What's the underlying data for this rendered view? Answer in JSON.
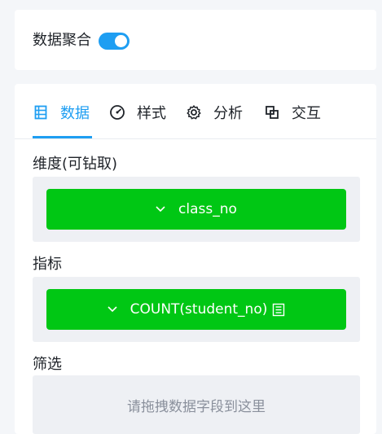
{
  "aggregation": {
    "label": "数据聚合",
    "enabled": true
  },
  "tabs": [
    {
      "label": "数据",
      "icon": "data-table-icon",
      "active": true
    },
    {
      "label": "样式",
      "icon": "dashboard-gauge-icon",
      "active": false
    },
    {
      "label": "分析",
      "icon": "gear-icon",
      "active": false
    },
    {
      "label": "交互",
      "icon": "overlap-squares-icon",
      "active": false
    }
  ],
  "dimension": {
    "label": "维度(可钻取)",
    "field": "class_no"
  },
  "metric": {
    "label": "指标",
    "field": "COUNT(student_no)"
  },
  "filter": {
    "label": "筛选",
    "placeholder": "请拖拽数据字段到这里"
  },
  "colors": {
    "accent": "#1e9ef2",
    "pill": "#00c714",
    "well": "#eef0f4"
  }
}
